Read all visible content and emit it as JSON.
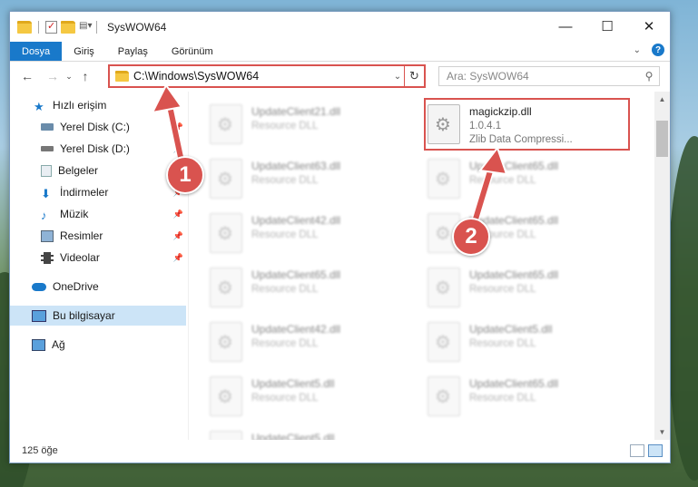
{
  "window": {
    "title": "SysWOW64",
    "controls": {
      "minimize": "—",
      "maximize": "☐",
      "close": "✕"
    }
  },
  "ribbon": {
    "tabs": [
      "Dosya",
      "Giriş",
      "Paylaş",
      "Görünüm"
    ],
    "active_tab": "Dosya"
  },
  "address": {
    "path": "C:\\Windows\\SysWOW64",
    "search_placeholder": "Ara: SysWOW64"
  },
  "sidebar": {
    "items": [
      {
        "label": "Hızlı erişim",
        "icon": "star-icon",
        "pinned": false
      },
      {
        "label": "Yerel Disk (C:)",
        "icon": "drive-icon",
        "pinned": true
      },
      {
        "label": "Yerel Disk (D:)",
        "icon": "drive-icon",
        "pinned": true
      },
      {
        "label": "Belgeler",
        "icon": "documents-icon",
        "pinned": true
      },
      {
        "label": "İndirmeler",
        "icon": "download-icon",
        "pinned": true
      },
      {
        "label": "Müzik",
        "icon": "music-icon",
        "pinned": true
      },
      {
        "label": "Resimler",
        "icon": "pictures-icon",
        "pinned": true
      },
      {
        "label": "Videolar",
        "icon": "video-icon",
        "pinned": true
      },
      {
        "label": "OneDrive",
        "icon": "cloud-icon",
        "pinned": false
      },
      {
        "label": "Bu bilgisayar",
        "icon": "computer-icon",
        "pinned": false,
        "selected": true
      },
      {
        "label": "Ağ",
        "icon": "network-icon",
        "pinned": false
      }
    ]
  },
  "files": {
    "left_column": [
      {
        "name": "UpdateClient21.dll",
        "type": "Resource DLL"
      },
      {
        "name": "UpdateClient63.dll",
        "type": "Resource DLL"
      },
      {
        "name": "UpdateClient42.dll",
        "type": "Resource DLL"
      },
      {
        "name": "UpdateClient65.dll",
        "type": "Resource DLL"
      },
      {
        "name": "UpdateClient42.dll",
        "type": "Resource DLL"
      },
      {
        "name": "UpdateClient5.dll",
        "type": "Resource DLL"
      },
      {
        "name": "UpdateClient5.dll",
        "type": "Resource DLL"
      }
    ],
    "highlighted": {
      "name": "magickzip.dll",
      "version": "1.0.4.1",
      "description": "Zlib Data Compressi..."
    },
    "right_column": [
      {
        "name": "UpdateClient65.dll",
        "type": "Resource DLL"
      },
      {
        "name": "UpdateClient65.dll",
        "type": "Resource DLL"
      },
      {
        "name": "UpdateClient65.dll",
        "type": "Resource DLL"
      },
      {
        "name": "UpdateClient5.dll",
        "type": "Resource DLL"
      },
      {
        "name": "UpdateClient65.dll",
        "type": "Resource DLL"
      }
    ]
  },
  "status": {
    "item_count": "125 öğe"
  },
  "callouts": {
    "one": "1",
    "two": "2"
  },
  "colors": {
    "accent": "#1979ca",
    "callout": "#d9534f",
    "selected": "#cce4f7"
  }
}
